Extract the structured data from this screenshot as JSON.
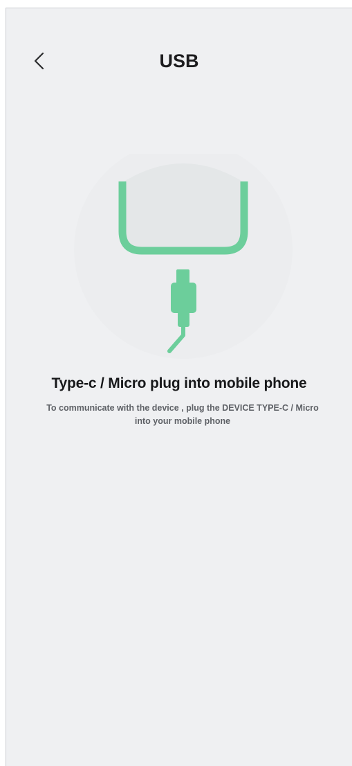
{
  "header": {
    "back_icon": "chevron-left-icon",
    "title": "USB"
  },
  "illustration": {
    "icon": "usb-device-plug-icon",
    "accent_color": "#6cce9b",
    "device_fill": "#e4e7e8",
    "halo_color": "#edeef0"
  },
  "main": {
    "headline": "Type-c / Micro plug into mobile phone",
    "description": "To communicate with the device , plug the DEVICE TYPE-C / Micro into your mobile phone"
  }
}
